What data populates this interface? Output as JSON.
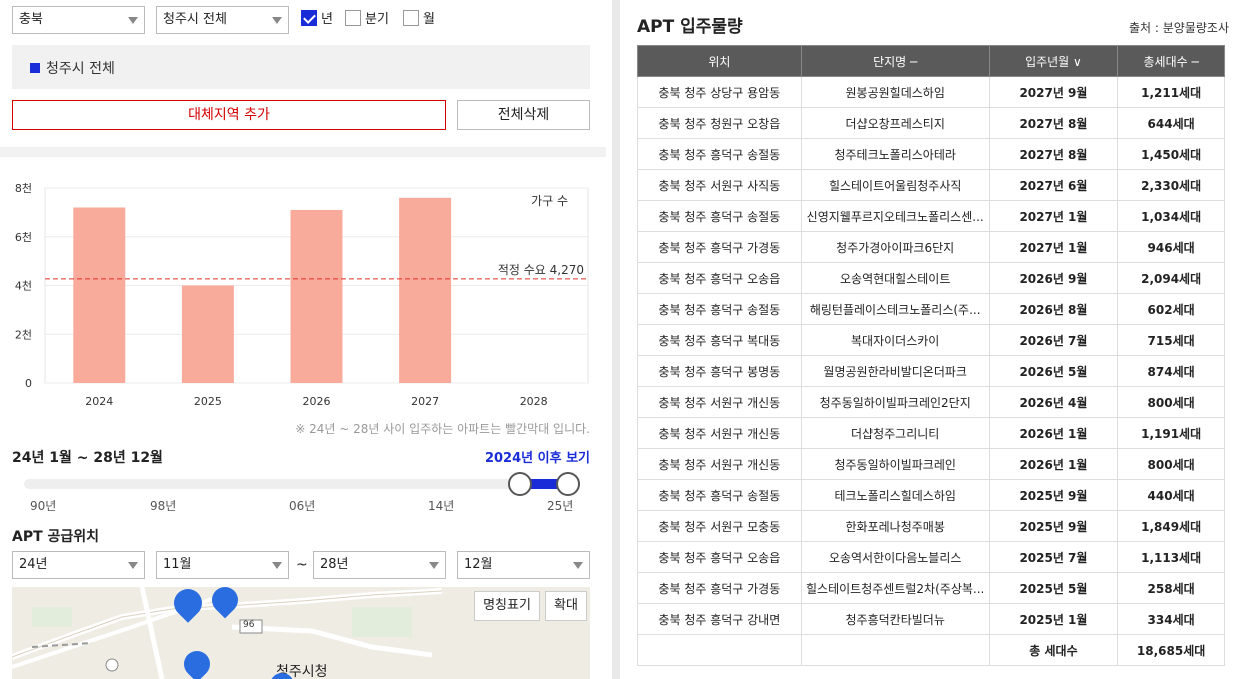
{
  "filters": {
    "province": "충북",
    "city": "청주시 전체",
    "period_options": [
      {
        "label": "년",
        "checked": true
      },
      {
        "label": "분기",
        "checked": false
      },
      {
        "label": "월",
        "checked": false
      }
    ]
  },
  "region_label": "청주시 전체",
  "buttons": {
    "add_region": "대체지역 추가",
    "delete_all": "전체삭제"
  },
  "chart_data": {
    "type": "bar",
    "categories": [
      "2024",
      "2025",
      "2026",
      "2027",
      "2028"
    ],
    "values": [
      7200,
      4000,
      7100,
      7600,
      0
    ],
    "ylabel": "가구 수",
    "yticks": [
      "0",
      "2천",
      "4천",
      "6천",
      "8천"
    ],
    "ylim": [
      0,
      8000
    ],
    "reference_line": {
      "label": "적정 수요 4,270",
      "value": 4270
    },
    "bar_color": "#f9ab9b",
    "grid": true
  },
  "chart_note": "※ 24년 ~ 28년 사이 입주하는 아파트는 빨간막대 입니다.",
  "period_text": "24년 1월 ~ 28년 12월",
  "after_link": "2024년 이후 보기",
  "slider_ticks": [
    "90년",
    "98년",
    "06년",
    "14년",
    "25년"
  ],
  "supply_title": "APT 공급위치",
  "range": {
    "from_year": "24년",
    "from_month": "11월",
    "sep": "~",
    "to_year": "28년",
    "to_month": "12월"
  },
  "map": {
    "btn_names": "명칭표기",
    "btn_zoom": "확대",
    "label_city_hall": "청주시청",
    "road_label": "96"
  },
  "table": {
    "title": "APT 입주물량",
    "source": "출처 : 분양물량조사",
    "headers": [
      "위치",
      "단지명 ─",
      "입주년월 ∨",
      "총세대수 ─"
    ],
    "rows": [
      [
        "충북 청주 상당구 용암동",
        "원봉공원힐데스하임",
        "2027년 9월",
        "1,211세대"
      ],
      [
        "충북 청주 청원구 오창읍",
        "더샵오창프레스티지",
        "2027년 8월",
        "644세대"
      ],
      [
        "충북 청주 흥덕구 송절동",
        "청주테크노폴리스아테라",
        "2027년 8월",
        "1,450세대"
      ],
      [
        "충북 청주 서원구 사직동",
        "힐스테이트어울림청주사직",
        "2027년 6월",
        "2,330세대"
      ],
      [
        "충북 청주 흥덕구 송절동",
        "신영지웰푸르지오테크노폴리스센...",
        "2027년 1월",
        "1,034세대"
      ],
      [
        "충북 청주 흥덕구 가경동",
        "청주가경아이파크6단지",
        "2027년 1월",
        "946세대"
      ],
      [
        "충북 청주 흥덕구 오송읍",
        "오송역현대힐스테이트",
        "2026년 9월",
        "2,094세대"
      ],
      [
        "충북 청주 흥덕구 송절동",
        "해링턴플레이스테크노폴리스(주...",
        "2026년 8월",
        "602세대"
      ],
      [
        "충북 청주 흥덕구 복대동",
        "복대자이더스카이",
        "2026년 7월",
        "715세대"
      ],
      [
        "충북 청주 흥덕구 봉명동",
        "월명공원한라비발디온더파크",
        "2026년 5월",
        "874세대"
      ],
      [
        "충북 청주 서원구 개신동",
        "청주동일하이빌파크레인2단지",
        "2026년 4월",
        "800세대"
      ],
      [
        "충북 청주 서원구 개신동",
        "더샵청주그리니티",
        "2026년 1월",
        "1,191세대"
      ],
      [
        "충북 청주 서원구 개신동",
        "청주동일하이빌파크레인",
        "2026년 1월",
        "800세대"
      ],
      [
        "충북 청주 흥덕구 송절동",
        "테크노폴리스힐데스하임",
        "2025년 9월",
        "440세대"
      ],
      [
        "충북 청주 서원구 모충동",
        "한화포레나청주매봉",
        "2025년 9월",
        "1,849세대"
      ],
      [
        "충북 청주 흥덕구 오송읍",
        "오송역서한이다음노블리스",
        "2025년 7월",
        "1,113세대"
      ],
      [
        "충북 청주 흥덕구 가경동",
        "힐스테이트청주센트럴2차(주상복...",
        "2025년 5월",
        "258세대"
      ],
      [
        "충북 청주 흥덕구 강내면",
        "청주흥덕칸타빌더뉴",
        "2025년 1월",
        "334세대"
      ]
    ],
    "total_label": "총 세대수",
    "total_value": "18,685세대"
  }
}
